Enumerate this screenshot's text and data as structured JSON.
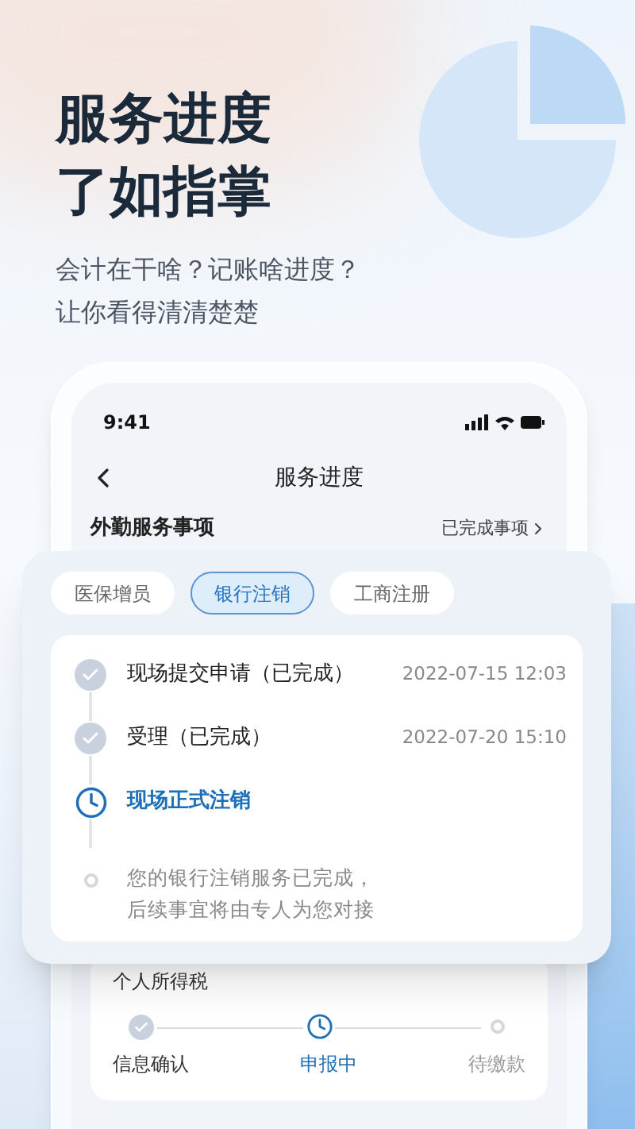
{
  "hero": {
    "title_lines": [
      "服务进度",
      "了如指掌"
    ],
    "subtitle_lines": [
      "会计在干啥？记账啥进度？",
      "让你看得清清楚楚"
    ]
  },
  "phone": {
    "status_time": "9:41",
    "nav_title": "服务进度",
    "section": {
      "title": "外勤服务事项",
      "link": "已完成事项"
    },
    "tabs": [
      {
        "label": "医保增员",
        "selected": false
      },
      {
        "label": "银行注销",
        "selected": true
      },
      {
        "label": "工商注册",
        "selected": false
      }
    ],
    "timeline": [
      {
        "kind": "done",
        "title": "现场提交申请（已完成）",
        "time": "2022-07-15 12:03"
      },
      {
        "kind": "done",
        "title": "受理（已完成）",
        "time": "2022-07-20 15:10"
      },
      {
        "kind": "current",
        "title": "现场正式注销"
      },
      {
        "kind": "note",
        "lines": [
          "您的银行注销服务已完成，",
          "后续事宜将由专人为您对接"
        ]
      }
    ],
    "tax_card": {
      "title": "个人所得税",
      "steps": [
        {
          "label": "信息确认",
          "kind": "done"
        },
        {
          "label": "申报中",
          "kind": "current"
        },
        {
          "label": "待缴款",
          "kind": "pending"
        }
      ]
    }
  }
}
